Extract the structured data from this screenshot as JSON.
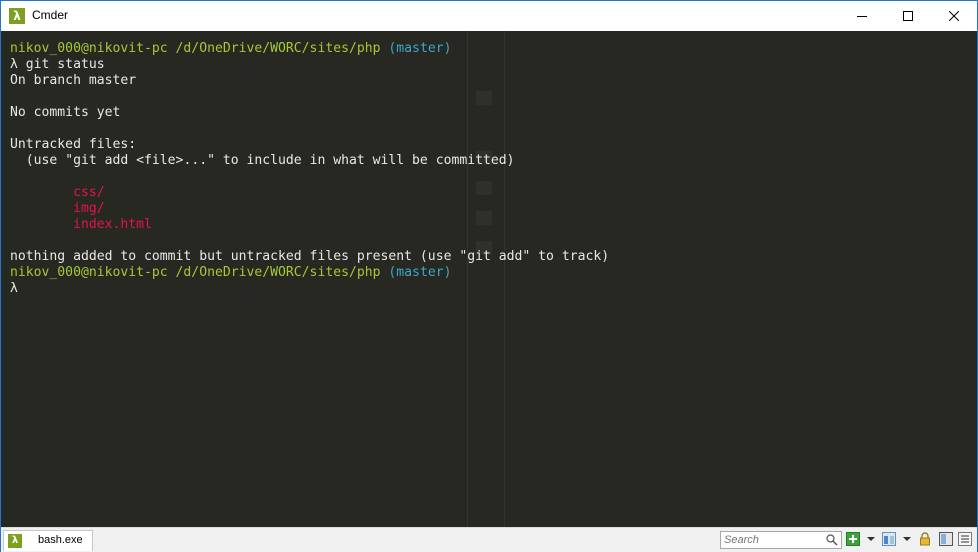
{
  "window": {
    "title": "Cmder",
    "app_icon_glyph": "λ"
  },
  "terminal": {
    "lines": [
      {
        "parts": [
          {
            "t": "nikov_000@nikovit-pc /d/OneDrive/WORC/sites/php",
            "c": "green"
          },
          {
            "t": " ",
            "c": ""
          },
          {
            "t": "(master)",
            "c": "cyan"
          }
        ]
      },
      {
        "parts": [
          {
            "t": "λ git status",
            "c": ""
          }
        ]
      },
      {
        "parts": [
          {
            "t": "On branch master",
            "c": ""
          }
        ]
      },
      {
        "parts": [
          {
            "t": "",
            "c": ""
          }
        ]
      },
      {
        "parts": [
          {
            "t": "No commits yet",
            "c": ""
          }
        ]
      },
      {
        "parts": [
          {
            "t": "",
            "c": ""
          }
        ]
      },
      {
        "parts": [
          {
            "t": "Untracked files:",
            "c": ""
          }
        ]
      },
      {
        "parts": [
          {
            "t": "  ",
            "c": ""
          },
          {
            "t": "(use \"git add <file>...\" to include in what will be committed)",
            "c": ""
          }
        ]
      },
      {
        "parts": [
          {
            "t": "",
            "c": ""
          }
        ]
      },
      {
        "parts": [
          {
            "t": "        ",
            "c": ""
          },
          {
            "t": "css/",
            "c": "red"
          }
        ]
      },
      {
        "parts": [
          {
            "t": "        ",
            "c": ""
          },
          {
            "t": "img/",
            "c": "red"
          }
        ]
      },
      {
        "parts": [
          {
            "t": "        ",
            "c": ""
          },
          {
            "t": "index.html",
            "c": "red"
          }
        ]
      },
      {
        "parts": [
          {
            "t": "",
            "c": ""
          }
        ]
      },
      {
        "parts": [
          {
            "t": "nothing added to commit but untracked files present (use \"git add\" to track)",
            "c": ""
          }
        ]
      },
      {
        "parts": [
          {
            "t": "nikov_000@nikovit-pc /d/OneDrive/WORC/sites/php",
            "c": "green"
          },
          {
            "t": " ",
            "c": ""
          },
          {
            "t": "(master)",
            "c": "cyan"
          }
        ]
      },
      {
        "parts": [
          {
            "t": "λ",
            "c": ""
          }
        ]
      }
    ]
  },
  "statusbar": {
    "tab_label": "bash.exe",
    "tab_icon_glyph": "λ",
    "search_placeholder": "Search"
  },
  "colors": {
    "terminal_bg": "#272822",
    "prompt_green": "#a6c837",
    "branch_cyan": "#3aa8ca",
    "untracked_red": "#e5124d",
    "accent": "#7ea022"
  }
}
